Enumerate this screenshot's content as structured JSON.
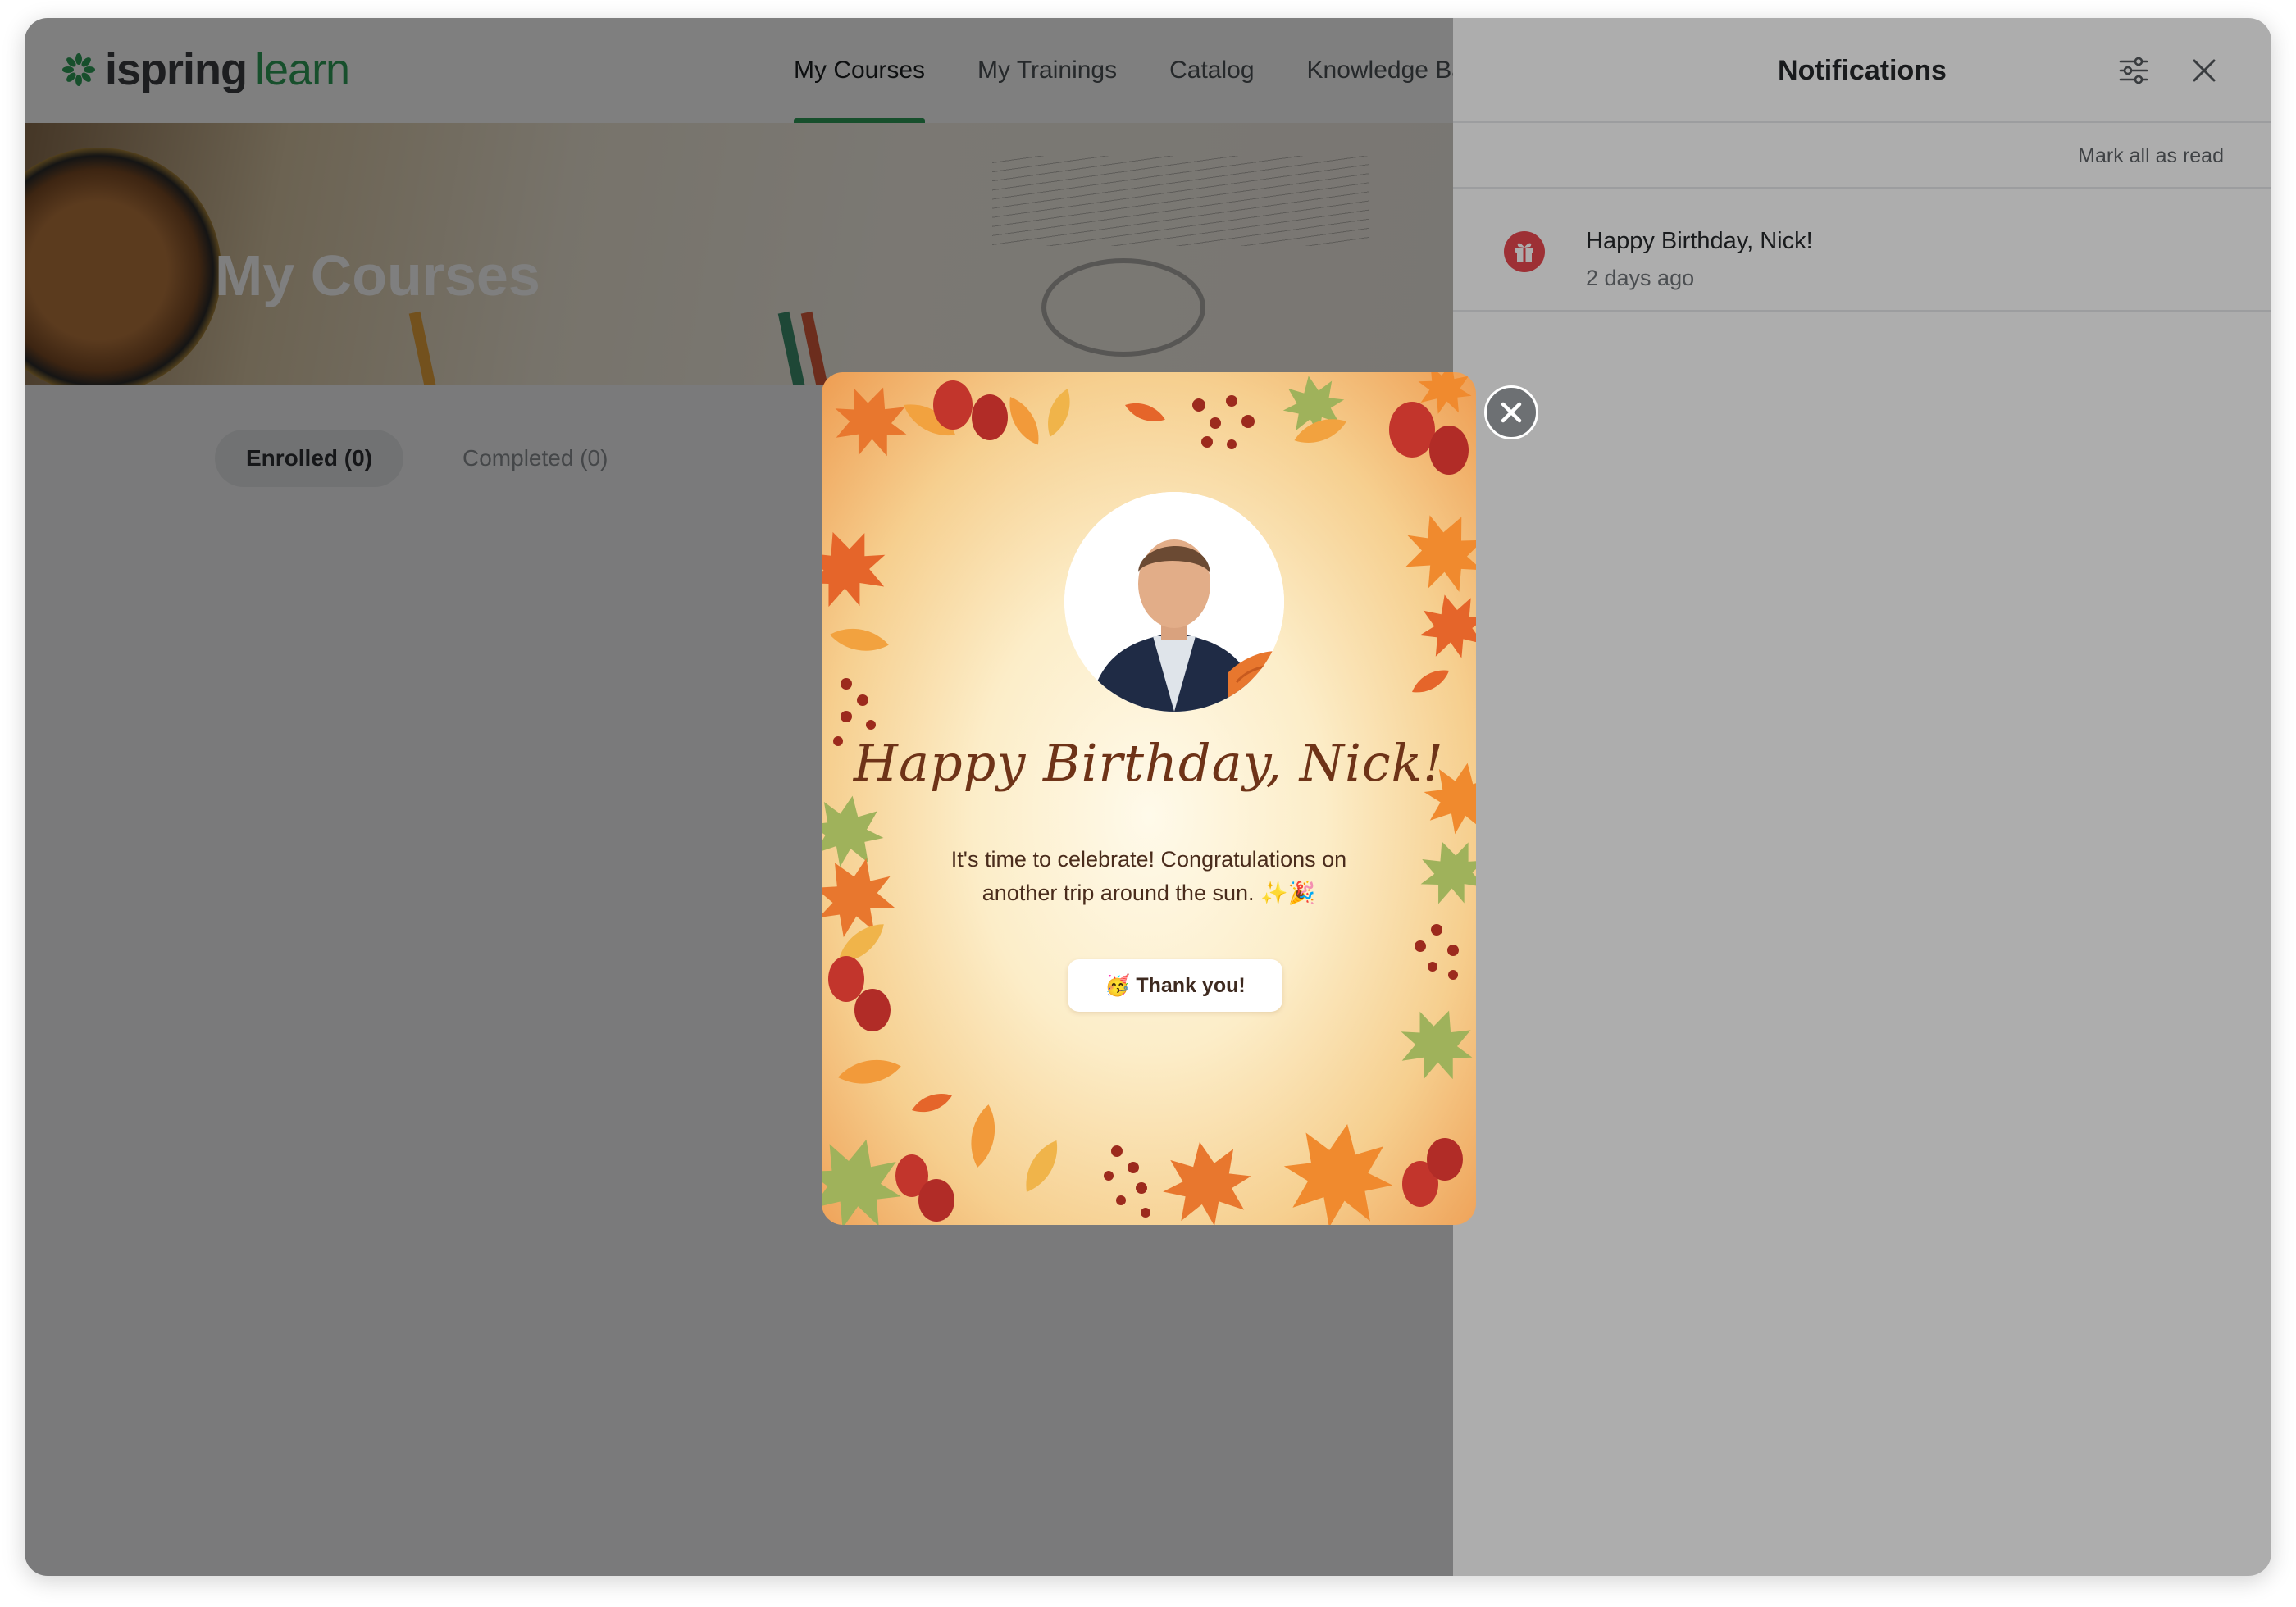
{
  "app": {
    "logo": {
      "word1": "ispring",
      "word2": "learn"
    },
    "nav": [
      {
        "label": "My Courses",
        "active": true
      },
      {
        "label": "My Trainings",
        "active": false
      },
      {
        "label": "Catalog",
        "active": false
      },
      {
        "label": "Knowledge Ba",
        "active": false
      }
    ],
    "hero_title": "My Courses",
    "tabs": [
      {
        "label": "Enrolled (0)",
        "active": true
      },
      {
        "label": "Completed (0)",
        "active": false
      }
    ]
  },
  "notifications": {
    "title": "Notifications",
    "mark_all_label": "Mark all as read",
    "items": [
      {
        "message": "Happy Birthday, Nick!",
        "time": "2 days ago",
        "icon": "gift-icon"
      }
    ]
  },
  "birthday_card": {
    "heading": "Happy Birthday, Nick!",
    "message": "It's time to celebrate! Congratulations on another trip around the sun. ✨🎉",
    "button_label": "🥳 Thank you!"
  },
  "colors": {
    "brand_green": "#2e9e59",
    "notification_badge": "#e8474e",
    "card_heading": "#6e3318"
  }
}
